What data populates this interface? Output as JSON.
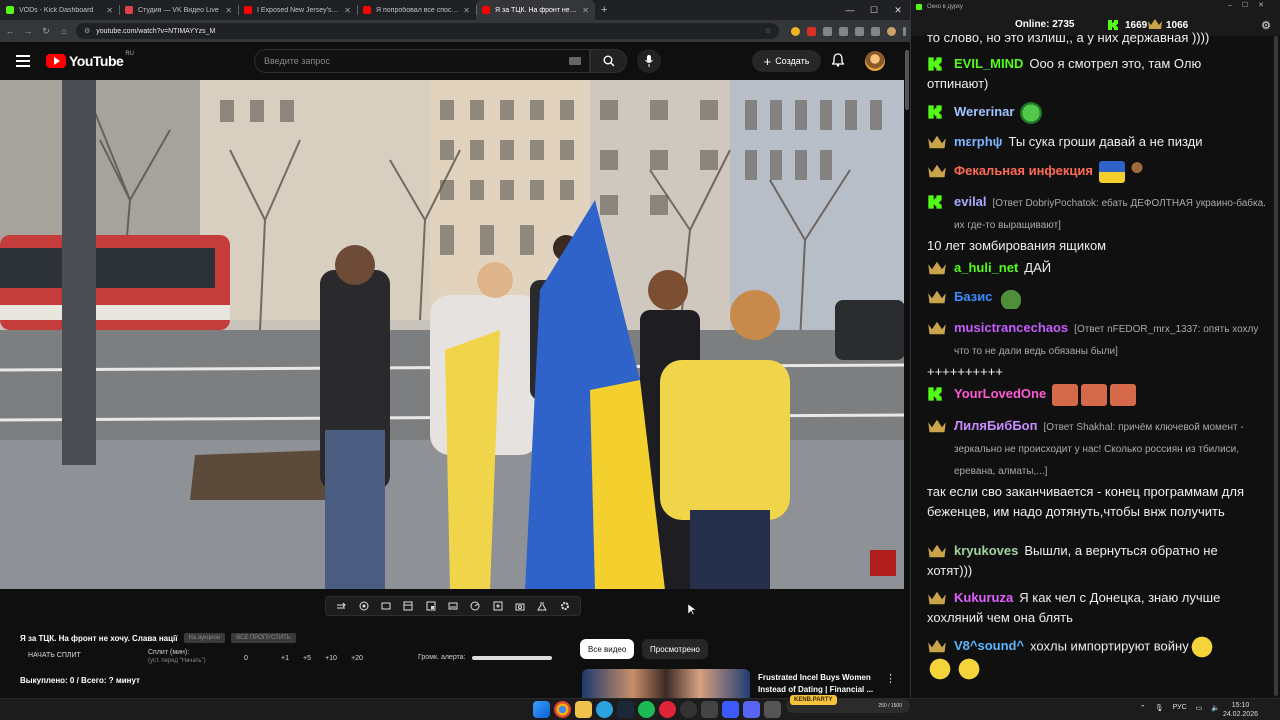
{
  "browser": {
    "tabs": [
      {
        "title": "VODs - Kick Dashboard",
        "color": "#53fc18",
        "active": false
      },
      {
        "title": "Студия — VK Видео Live",
        "color": "#e2414c",
        "active": false
      },
      {
        "title": "I Exposed New Jersey's Jewish",
        "color": "#ff0000",
        "active": false
      },
      {
        "title": "Я попробовал все способы б",
        "color": "#ff0000",
        "active": false
      },
      {
        "title": "Я за ТЦК. На фронт не хоч",
        "color": "#ff0000",
        "active": true
      }
    ],
    "url": "youtube.com/watch?v=NTIMAYYzs_M"
  },
  "youtube": {
    "logo_text": "YouTube",
    "region": "RU",
    "search_placeholder": "Введите запрос",
    "create_label": "Создать",
    "video_title": "Я за ТЦК. На фронт не хочу. Слава нації",
    "pill_1": "На аукцион",
    "pill_2": "ВСЕ ПРОПУСТИТЬ",
    "split_label": "НАЧАТЬ СПЛИТ",
    "split_min_label": "Сплит (мин):",
    "split_min_hint": "(уст. перед \"Начать\")",
    "split_values": [
      "0",
      "+1",
      "+5",
      "+10",
      "+20"
    ],
    "alert_label": "Громк. алерта:",
    "alert_volume": 1.0,
    "bought_label": "Выкуплено: 0 / Всего: ? минут",
    "chip_all": "Все видео",
    "chip_watched": "Просмотрено",
    "rec_title": "Frustrated Incel Buys Women Instead of Dating | Financial ..."
  },
  "chat": {
    "window_title": "Окно в дурку",
    "online_label": "Online:",
    "online_count": "2735",
    "kick_count": "1669",
    "gold_count": "1066",
    "messages": [
      {
        "badge": "none",
        "user": "",
        "color": "#eeeeee",
        "text": "то слово, но это излиш,, а у них державная ))))",
        "reply": "",
        "continuation": ""
      },
      {
        "badge": "kick",
        "user": "EVIL_MIND",
        "color": "#53fc18",
        "text": "Ооо я смотрел это, там Олю",
        "reply": "",
        "continuation": "отпинают)"
      },
      {
        "badge": "kick",
        "user": "Wererinar",
        "color": "#9fc3ff",
        "text": "",
        "reply": "",
        "continuation": "",
        "emote": "frog"
      },
      {
        "badge": "crown",
        "user": "mεrphψ",
        "color": "#7fb3ff",
        "text": "Ты сука гроши давай а не пизди",
        "reply": "",
        "continuation": ""
      },
      {
        "badge": "crown",
        "user": "Фекальная инфекция",
        "color": "#ff6a55",
        "text": "",
        "reply": "",
        "continuation": "",
        "emote": "flag"
      },
      {
        "badge": "kick",
        "user": "evilal",
        "color": "#aaaaff",
        "text": "",
        "reply": "[Ответ DobriyPochatok: ебать ДЕФОЛТНАЯ украино-бабка. их где-то выращивают]",
        "continuation": "10 лет зомбирования ящиком"
      },
      {
        "badge": "crown",
        "user": "a_huli_net",
        "color": "#53fc18",
        "text": "ДАЙ",
        "reply": "",
        "continuation": ""
      },
      {
        "badge": "crown",
        "user": "Базис",
        "color": "#3a8cff",
        "text": "",
        "reply": "",
        "continuation": "",
        "emote": "pepe"
      },
      {
        "badge": "crown",
        "user": "musictrancechaos",
        "color": "#c55cff",
        "text": "",
        "reply": "[Ответ nFEDOR_mrx_1337: опять хохлу что то не дали ведь обязаны были]",
        "continuation": "++++++++++"
      },
      {
        "badge": "kick",
        "user": "YourLovedOne",
        "color": "#ff5ad6",
        "text": "",
        "reply": "",
        "continuation": "",
        "emote": "faces"
      },
      {
        "badge": "crown",
        "user": "ЛиляБибБоп",
        "color": "#c88cff",
        "text": "",
        "reply": "[Ответ Shakhal: причём ключевой момент - зеркально не происходит у нас! Сколько россиян из тбилиси, еревана, алматы,...]",
        "continuation": "так если сво заканчивается - конец программам для беженцев, им надо дотянуть,чтобы внж получить"
      },
      {
        "badge": "crown",
        "user": "kryukoves",
        "color": "#9fd4a0",
        "text": "Вышли, а вернуться обратно не",
        "reply": "",
        "continuation": "хотят)))"
      },
      {
        "badge": "crown",
        "user": "Kukuruza",
        "color": "#e35fff",
        "text": "Я как чел с Донецка, знаю лучше",
        "reply": "",
        "continuation": "хохляний чем она блять"
      },
      {
        "badge": "crown",
        "user": "V8^sound^",
        "color": "#5ab7ff",
        "text": "хохлы импортируют войну",
        "reply": "",
        "continuation": "",
        "emote": "laugh"
      }
    ]
  },
  "taskbar": {
    "widget_label": "KENB.PARTY",
    "widget_value": "250 / 1500",
    "lang": "РУС",
    "time": "15:10",
    "date": "24.02.2026"
  },
  "colors": {
    "kick_green": "#53fc18",
    "youtube_red": "#ff0000"
  }
}
